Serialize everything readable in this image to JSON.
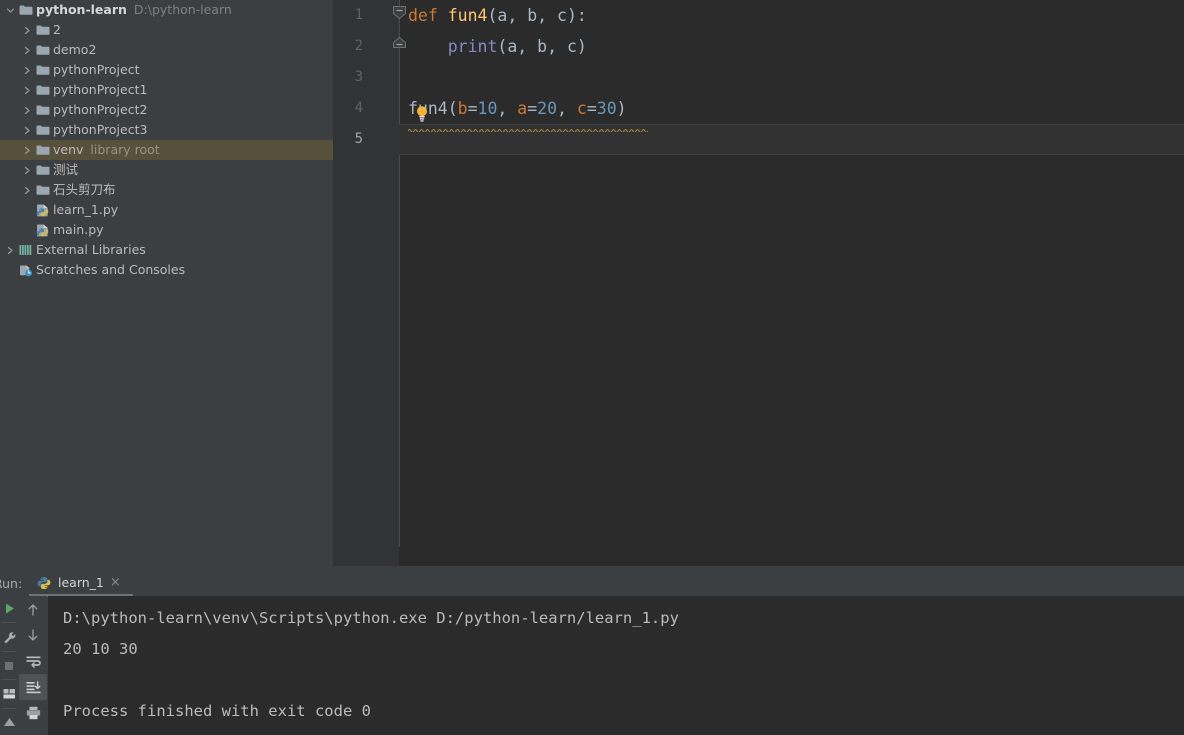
{
  "project_tree": {
    "name": "project-tool-window",
    "rows": [
      {
        "label": "python-learn",
        "sub": "D:\\python-learn",
        "icon": "folder-icon",
        "arrow": "chevron-down-icon",
        "indent": 0,
        "bold": true,
        "selected": false,
        "kind": "project-root"
      },
      {
        "label": "2",
        "sub": "",
        "icon": "folder-icon",
        "arrow": "chevron-right-icon",
        "indent": 1,
        "bold": false,
        "selected": false,
        "kind": "folder"
      },
      {
        "label": "demo2",
        "sub": "",
        "icon": "folder-icon",
        "arrow": "chevron-right-icon",
        "indent": 1,
        "bold": false,
        "selected": false,
        "kind": "folder"
      },
      {
        "label": "pythonProject",
        "sub": "",
        "icon": "folder-icon",
        "arrow": "chevron-right-icon",
        "indent": 1,
        "bold": false,
        "selected": false,
        "kind": "folder"
      },
      {
        "label": "pythonProject1",
        "sub": "",
        "icon": "folder-icon",
        "arrow": "chevron-right-icon",
        "indent": 1,
        "bold": false,
        "selected": false,
        "kind": "folder"
      },
      {
        "label": "pythonProject2",
        "sub": "",
        "icon": "folder-icon",
        "arrow": "chevron-right-icon",
        "indent": 1,
        "bold": false,
        "selected": false,
        "kind": "folder"
      },
      {
        "label": "pythonProject3",
        "sub": "",
        "icon": "folder-icon",
        "arrow": "chevron-right-icon",
        "indent": 1,
        "bold": false,
        "selected": false,
        "kind": "folder"
      },
      {
        "label": "venv",
        "sub": "library root",
        "icon": "folder-icon",
        "arrow": "chevron-right-icon",
        "indent": 1,
        "bold": false,
        "selected": true,
        "kind": "folder"
      },
      {
        "label": "测试",
        "sub": "",
        "icon": "folder-icon",
        "arrow": "chevron-right-icon",
        "indent": 1,
        "bold": false,
        "selected": false,
        "kind": "folder"
      },
      {
        "label": "石头剪刀布",
        "sub": "",
        "icon": "folder-icon",
        "arrow": "chevron-right-icon",
        "indent": 1,
        "bold": false,
        "selected": false,
        "kind": "folder"
      },
      {
        "label": "learn_1.py",
        "sub": "",
        "icon": "python-file-icon",
        "arrow": "",
        "indent": 1,
        "bold": false,
        "selected": false,
        "kind": "python-file"
      },
      {
        "label": "main.py",
        "sub": "",
        "icon": "python-file-icon",
        "arrow": "",
        "indent": 1,
        "bold": false,
        "selected": false,
        "kind": "python-file"
      },
      {
        "label": "External Libraries",
        "sub": "",
        "icon": "external-libraries-icon",
        "arrow": "chevron-right-icon",
        "indent": 0,
        "bold": false,
        "selected": false,
        "kind": "node"
      },
      {
        "label": "Scratches and Consoles",
        "sub": "",
        "icon": "scratches-icon",
        "arrow": "",
        "indent": 0,
        "bold": false,
        "selected": false,
        "kind": "node"
      }
    ]
  },
  "editor": {
    "name": "code-editor",
    "current_line": 5,
    "line_numbers": [
      "1",
      "2",
      "3",
      "4",
      "5"
    ],
    "lines": [
      {
        "n": "1",
        "tokens": [
          {
            "t": "def ",
            "c": "kw"
          },
          {
            "t": "fun4",
            "c": "fn"
          },
          {
            "t": "(a, b, c):",
            "c": "pln"
          }
        ]
      },
      {
        "n": "2",
        "tokens": [
          {
            "t": "    ",
            "c": "pln"
          },
          {
            "t": "print",
            "c": "bi"
          },
          {
            "t": "(a, b, c)",
            "c": "pln"
          }
        ]
      },
      {
        "n": "3",
        "tokens": []
      },
      {
        "n": "4",
        "tokens": [
          {
            "t": "fun4(",
            "c": "pln"
          },
          {
            "t": "b",
            "c": "kwarg"
          },
          {
            "t": "=",
            "c": "pln"
          },
          {
            "t": "10",
            "c": "num"
          },
          {
            "t": ", ",
            "c": "pln"
          },
          {
            "t": "a",
            "c": "kwarg"
          },
          {
            "t": "=",
            "c": "pln"
          },
          {
            "t": "20",
            "c": "num"
          },
          {
            "t": ", ",
            "c": "pln"
          },
          {
            "t": "c",
            "c": "kwarg"
          },
          {
            "t": "=",
            "c": "pln"
          },
          {
            "t": "30",
            "c": "num"
          },
          {
            "t": ")",
            "c": "pln"
          }
        ]
      },
      {
        "n": "5",
        "tokens": []
      }
    ],
    "fold_markers": [
      "fold-collapse-icon",
      "fold-end-icon"
    ],
    "intention_bulb": "intention-bulb-icon",
    "colors": {
      "background": "#2b2b2b",
      "gutter": "#313335",
      "keyword": "#cc7832",
      "function": "#ffc66d",
      "builtin": "#8888c6",
      "number": "#6897bb",
      "plain": "#a9b7c6",
      "current_line": "#323232"
    }
  },
  "run_panel": {
    "name": "run-tool-window",
    "label": "Run:",
    "tab": {
      "title": "learn_1",
      "icon": "python-file-icon",
      "close": "×"
    },
    "toolbar_primary": [
      {
        "name": "rerun-icon",
        "glyph": "run"
      },
      {
        "name": "edit-configurations-icon",
        "glyph": "wrench"
      },
      {
        "name": "stop-icon",
        "glyph": "stop"
      },
      {
        "name": "layout-settings-icon",
        "glyph": "layout"
      },
      {
        "name": "pin-tab-icon",
        "glyph": "pin"
      }
    ],
    "toolbar_secondary": [
      {
        "name": "up-the-stack-trace-icon",
        "glyph": "arrow-up",
        "active": false
      },
      {
        "name": "down-the-stack-trace-icon",
        "glyph": "arrow-down",
        "active": false
      },
      {
        "name": "soft-wrap-icon",
        "glyph": "soft-wrap",
        "active": false
      },
      {
        "name": "scroll-to-end-icon",
        "glyph": "scroll-end",
        "active": true
      },
      {
        "name": "print-icon",
        "glyph": "print",
        "active": false
      }
    ],
    "console_lines": [
      "D:\\python-learn\\venv\\Scripts\\python.exe D:/python-learn/learn_1.py",
      "20 10 30",
      "",
      "Process finished with exit code 0"
    ]
  }
}
